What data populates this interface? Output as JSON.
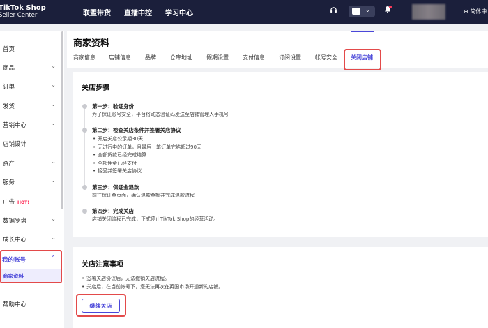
{
  "header": {
    "logo_line1": "TikTok Shop",
    "logo_line2": "Seller Center",
    "nav": [
      "联盟带货",
      "直播中控",
      "学习中心"
    ],
    "language": "简体中"
  },
  "sidebar": {
    "items": [
      {
        "label": "首页",
        "chevron": false
      },
      {
        "label": "商品",
        "chevron": true
      },
      {
        "label": "订单",
        "chevron": true
      },
      {
        "label": "发货",
        "chevron": true
      },
      {
        "label": "营销中心",
        "chevron": true
      },
      {
        "label": "店铺设计",
        "chevron": false
      },
      {
        "label": "资产",
        "chevron": true
      },
      {
        "label": "服务",
        "chevron": true
      },
      {
        "label": "广告",
        "chevron": false,
        "badge": "HOT!"
      },
      {
        "label": "数据罗盘",
        "chevron": true
      },
      {
        "label": "成长中心",
        "chevron": true
      }
    ],
    "my_account": "我的账号",
    "my_account_sub": "商家资料",
    "help": "帮助中心"
  },
  "page": {
    "title": "商家资料",
    "tabs": [
      "商家信息",
      "店铺信息",
      "品牌",
      "仓库地址",
      "假期设置",
      "支付信息",
      "订阅设置",
      "帐号安全",
      "关闭店铺"
    ],
    "active_tab": "关闭店铺"
  },
  "steps_card": {
    "title": "关店步骤",
    "step1_head": "第一步：验证身份",
    "step1_text": "为了保证账号安全，平台将动态验证码发送至店铺管理人手机号",
    "step2_head": "第二步：检查关店条件并签署关店协议",
    "step2_bullets": [
      "开启关店公示期30天",
      "无进行中的订单，且最后一笔订单完结超过90天",
      "全部货款已经完成结算",
      "全部佣金已经支付",
      "接受并签署关店协议"
    ],
    "step3_head": "第三步：保证金退款",
    "step3_text": "前往保证金页面，确认退款金额并完成退款流程",
    "step4_head": "第四步：完成关店",
    "step4_text": "店铺关闭流程已完成，正式停止TikTok Shop的经营活动。"
  },
  "notes_card": {
    "title": "关店注意事项",
    "notes": [
      "签署关店协议后，无法撤销关店流程。",
      "关店后，在当前帐号下，您无法再次在英国市场开通新的店铺。"
    ],
    "button": "继续关店"
  },
  "colors": {
    "topbar": "#1b1f3b",
    "accent": "#4a47d9",
    "highlight": "#e34a4a"
  }
}
